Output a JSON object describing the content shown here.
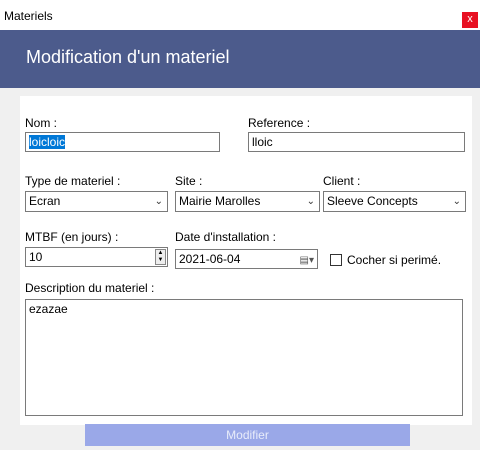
{
  "window": {
    "title": "Materiels",
    "close_label": "x"
  },
  "header": {
    "title": "Modification d'un materiel"
  },
  "form": {
    "nom_label": "Nom :",
    "nom_value": "loicloic",
    "reference_label": "Reference :",
    "reference_value": "lloic",
    "type_label": "Type de materiel :",
    "type_value": "Ecran",
    "site_label": "Site :",
    "site_value": "Mairie Marolles",
    "client_label": "Client :",
    "client_value": "Sleeve Concepts",
    "mtbf_label": "MTBF (en jours) :",
    "mtbf_value": "10",
    "date_label": "Date d'installation :",
    "date_value": "2021-06-04",
    "perime_label": "Cocher si  perimé.",
    "description_label": "Description du materiel :",
    "description_value": "ezazae"
  },
  "actions": {
    "submit_label": "Modifier"
  },
  "icons": {
    "dropdown": "chevron-down-icon",
    "calendar": "calendar-icon",
    "spinner": "spinner-icon",
    "close": "close-icon"
  }
}
